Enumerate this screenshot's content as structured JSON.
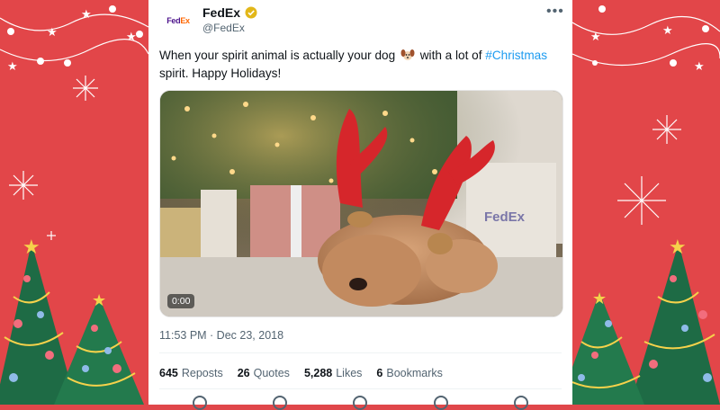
{
  "tweet": {
    "display_name": "FedEx",
    "handle": "@FedEx",
    "avatar_text_fed": "Fed",
    "avatar_text_ex": "Ex",
    "text_before_emoji": "When your spirit animal is actually your dog",
    "emoji": "dog-face-emoji",
    "text_after_emoji": " with a lot of ",
    "hashtag": "#Christmas",
    "text_end": "spirit. Happy Holidays!",
    "video_time": "0:00",
    "video_brand_text": "FedEx",
    "timestamp": "11:53 PM · Dec 23, 2018",
    "stats": [
      {
        "count": "645",
        "label": "Reposts"
      },
      {
        "count": "26",
        "label": "Quotes"
      },
      {
        "count": "5,288",
        "label": "Likes"
      },
      {
        "count": "6",
        "label": "Bookmarks"
      }
    ]
  },
  "colors": {
    "background_red": "#e24649",
    "verified_gold": "#e2b719",
    "hashtag_blue": "#1d9bf0",
    "fedex_purple": "#4d148c",
    "fedex_orange": "#ff6600"
  },
  "icons": [
    "verified-badge-icon",
    "more-options-icon",
    "reply-icon",
    "repost-icon",
    "like-icon",
    "bookmark-icon",
    "share-icon"
  ]
}
